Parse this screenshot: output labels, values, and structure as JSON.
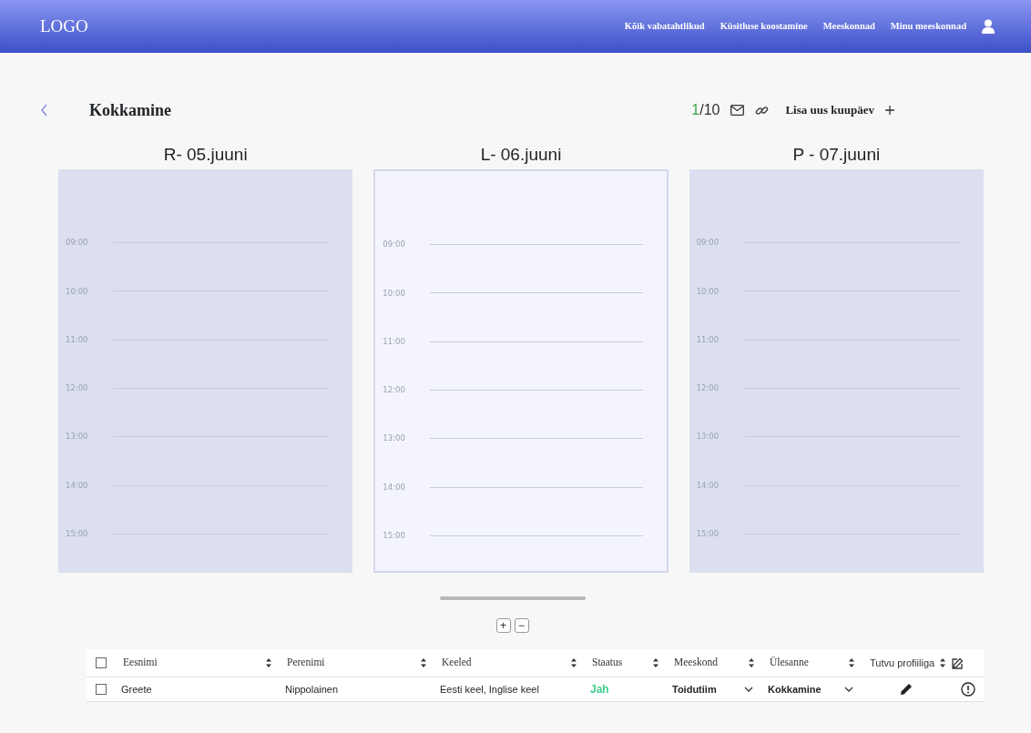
{
  "navbar": {
    "logo": "LOGO",
    "links": [
      "Kõik vabatahtlikud",
      "Küsitluse koostamine",
      "Meeskonnad",
      "Minu meeskonnad"
    ]
  },
  "page": {
    "title": "Kokkamine",
    "counter": {
      "current": "1",
      "total": "/10"
    },
    "add_date": "Lisa uus kuupäev"
  },
  "days": [
    {
      "label": "R- 05.juuni",
      "selected": false,
      "times": [
        "09:00",
        "10:00",
        "11:00",
        "12:00",
        "13:00",
        "14:00",
        "15:00"
      ]
    },
    {
      "label": "L- 06.juuni",
      "selected": true,
      "times": [
        "09:00",
        "10:00",
        "11:00",
        "12:00",
        "13:00",
        "14:00",
        "15:00"
      ]
    },
    {
      "label": "P - 07.juuni",
      "selected": false,
      "times": [
        "09:00",
        "10:00",
        "11:00",
        "12:00",
        "13:00",
        "14:00",
        "15:00"
      ]
    }
  ],
  "zoom_buttons": [
    "+",
    "−"
  ],
  "table": {
    "select_all": {
      "checked": false
    },
    "columns": [
      {
        "label": "Eesnimi",
        "kind": "serif"
      },
      {
        "label": "Perenimi",
        "kind": "serif"
      },
      {
        "label": "Keeled",
        "kind": "serif"
      },
      {
        "label": "Staatus",
        "kind": "serif"
      },
      {
        "label": "Meeskond",
        "kind": "serif"
      },
      {
        "label": "Ülesanne",
        "kind": "serif"
      },
      {
        "label": "Tutvu profiiliga",
        "kind": "sans"
      }
    ],
    "rows": [
      {
        "checked": false,
        "first_name": "Greete",
        "last_name": "Nippolainen",
        "languages": "Eesti keel, Inglise keel",
        "status": "Jah",
        "color": "#3ecf8e",
        "team": "Toidutiim",
        "task": "Kokkamine"
      }
    ]
  }
}
